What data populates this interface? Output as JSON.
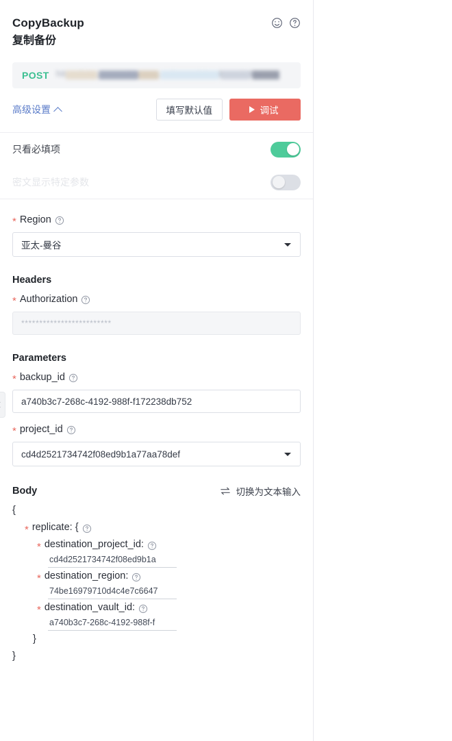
{
  "header": {
    "title_en": "CopyBackup",
    "title_cn": "复制备份",
    "icons": [
      "smiley-icon",
      "help-circle-icon"
    ]
  },
  "url_bar": {
    "method": "POST",
    "url_masked": "https://vbs.ap-southeast-2.myhuaweicloud.com/v3/"
  },
  "actions": {
    "advanced_settings_label": "高级设置",
    "fill_defaults_label": "填写默认值",
    "debug_label": "调试"
  },
  "toggles": [
    {
      "label": "只看必填项",
      "state": "on",
      "disabled": false
    },
    {
      "label": "密文显示特定参数",
      "state": "off",
      "disabled": true
    }
  ],
  "region": {
    "label": "Region",
    "required": true,
    "value": "亚太-曼谷"
  },
  "headers_section": {
    "title": "Headers",
    "fields": [
      {
        "label": "Authorization",
        "required": true,
        "value": "*************************",
        "masked": true
      }
    ]
  },
  "parameters_section": {
    "title": "Parameters",
    "fields": [
      {
        "label": "backup_id",
        "required": true,
        "value": "a740b3c7-268c-4192-988f-f172238db752",
        "type": "text"
      },
      {
        "label": "project_id",
        "required": true,
        "value": "cd4d2521734742f08ed9b1a77aa78def",
        "type": "select"
      }
    ]
  },
  "body_section": {
    "title": "Body",
    "switch_label": "切换为文本输入",
    "open_brace": "{",
    "close_brace": "}",
    "inner_close_brace": "}",
    "replicate_label": "replicate: {",
    "fields": [
      {
        "label": "destination_project_id:",
        "required": true,
        "value": "cd4d2521734742f08ed9b1a"
      },
      {
        "label": "destination_region:",
        "required": true,
        "value": "74be16979710d4c4e7c6647"
      },
      {
        "label": "destination_vault_id:",
        "required": true,
        "value": "a740b3c7-268c-4192-988f-f"
      }
    ]
  },
  "colors": {
    "method_green": "#3bbf91",
    "debug_red": "#ea6a62",
    "link_blue": "#5b7cc9",
    "required_star": "#e8675d",
    "toggle_on": "#4ecb9a"
  }
}
